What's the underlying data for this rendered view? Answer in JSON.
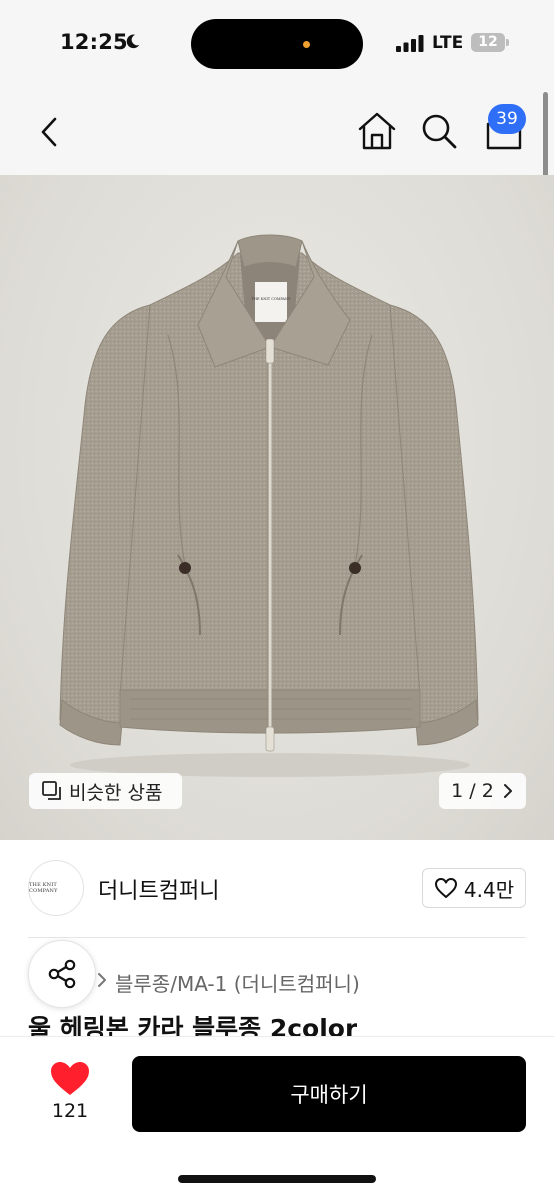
{
  "status_bar": {
    "time": "12:25",
    "carrier": "LTE",
    "battery": "12"
  },
  "nav": {
    "cart_count": "39",
    "icons": [
      "chevron-left-icon",
      "home-icon",
      "search-icon",
      "cart-icon"
    ]
  },
  "gallery": {
    "similar_label": "비슷한 상품",
    "page_indicator": "1 / 2",
    "product_tag": "THE KNIT COMPANY"
  },
  "shop": {
    "logo_text": "THE KNIT COMPANY",
    "name": "더니트컴퍼니",
    "favorites": "4.4만"
  },
  "product": {
    "category": "블루종/MA-1 (더니트컴퍼니)",
    "title": "울 헤링본 카라 블루종 2color"
  },
  "bottom_bar": {
    "like_count": "121",
    "buy_label": "구매하기"
  },
  "colors": {
    "badge": "#2f6ef6",
    "heart": "#ff1f2d",
    "buy_button": "#000000",
    "jacket": "#a49c8e"
  }
}
